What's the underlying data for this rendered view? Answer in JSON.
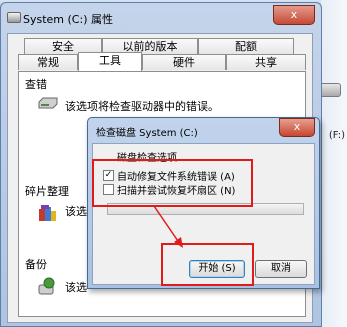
{
  "background": {
    "drive_label": "(F:)"
  },
  "properties": {
    "title": "System (C:) 属性",
    "close_label": "x",
    "tabs_row1": [
      "安全",
      "以前的版本",
      "配额"
    ],
    "tabs_row2": [
      "常规",
      "工具",
      "硬件",
      "共享"
    ],
    "active_tab": "工具",
    "groups": {
      "check": {
        "title": "查错",
        "text": "该选项将检查驱动器中的错误。"
      },
      "defrag": {
        "title": "碎片整理",
        "text": "该选"
      },
      "backup": {
        "title": "备份",
        "text": "该选"
      }
    }
  },
  "dialog": {
    "title": "检查磁盘 System (C:)",
    "close_label": "x",
    "options_legend": "磁盘检查选项",
    "option1_label": "自动修复文件系统错误 (A)",
    "option1_checked": true,
    "option1_mark": "✓",
    "option2_label": "扫描并尝试恢复坏扇区 (N)",
    "option2_checked": false,
    "start_button": "开始 (S)",
    "cancel_button": "取消"
  },
  "colors": {
    "highlight": "#e01b1b",
    "title_bar": "#aec4e2"
  }
}
